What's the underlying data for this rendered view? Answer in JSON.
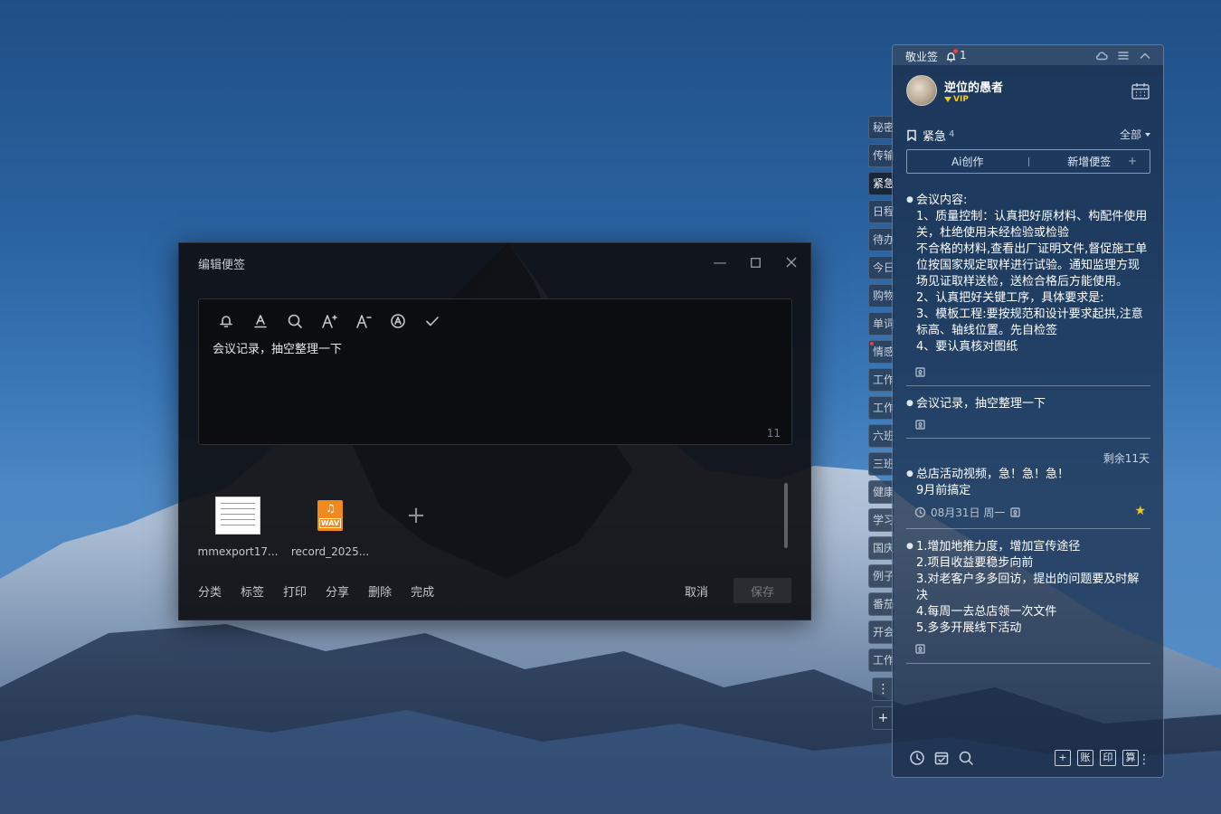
{
  "editor": {
    "title": "编辑便签",
    "note_text": "会议记录，抽空整理一下",
    "char_count": "11",
    "attachments": [
      {
        "name": "mmexport17...",
        "type": "image"
      },
      {
        "name": "record_2025...",
        "type": "audio",
        "badge": "WAV"
      }
    ],
    "footer": {
      "classify": "分类",
      "tags": "标签",
      "print": "打印",
      "share": "分享",
      "delete": "删除",
      "done": "完成",
      "cancel": "取消",
      "save": "保存"
    },
    "toolbar_icons": [
      "reminder-bell-icon",
      "text-underline-icon",
      "search-icon",
      "font-increase-icon",
      "font-decrease-icon",
      "text-recognition-icon",
      "check-icon"
    ]
  },
  "side_tabs": [
    "秘密",
    "传输",
    "紧急",
    "日程",
    "待办",
    "今日",
    "购物",
    "单词",
    "情感",
    "工作",
    "工作",
    "六班",
    "三班",
    "健康",
    "学习",
    "国庆",
    "例子",
    "番茄",
    "开会",
    "工作"
  ],
  "side_tab_active": "紧急",
  "panel": {
    "app_name": "敬业签",
    "notify_count": "1",
    "username": "逆位的愚者",
    "vip": "VIP",
    "category": {
      "name": "紧急",
      "count": "4",
      "filter": "全部"
    },
    "actions": {
      "ai": "Ai创作",
      "new": "新增便签",
      "plus": "+"
    },
    "notes": [
      {
        "content": "会议内容:\n1、质量控制：认真把好原材料、构配件使用关，杜绝使用未经检验或检验\n不合格的材料,查看出厂证明文件,督促施工单位按国家规定取样进行试验。通知监理方现场见证取样送检，送检合格后方能使用。\n2、认真把好关键工序，具体要求是:\n3、模板工程:要按规范和设计要求起拱,注意标高、轴线位置。先自检签\n4、要认真核对图纸"
      },
      {
        "content": "会议记录，抽空整理一下"
      },
      {
        "remaining": "剩余11天",
        "content": "总店活动视频，急！急！急！\n9月前搞定",
        "date": "08月31日 周一",
        "starred": true
      },
      {
        "content": "1.增加地推力度，增加宣传途径\n2.项目收益要稳步向前\n3.对老客户多多回访，提出的问题要及时解决\n4.每周一去总店领一次文件\n5.多多开展线下活动"
      }
    ],
    "bottom_labels": {
      "add": "+",
      "account": "账",
      "print": "印",
      "calc": "算"
    }
  },
  "colors": {
    "accent_gold": "#f3c623",
    "notify_red": "#e0453a",
    "audio_orange": "#f08a1f"
  }
}
